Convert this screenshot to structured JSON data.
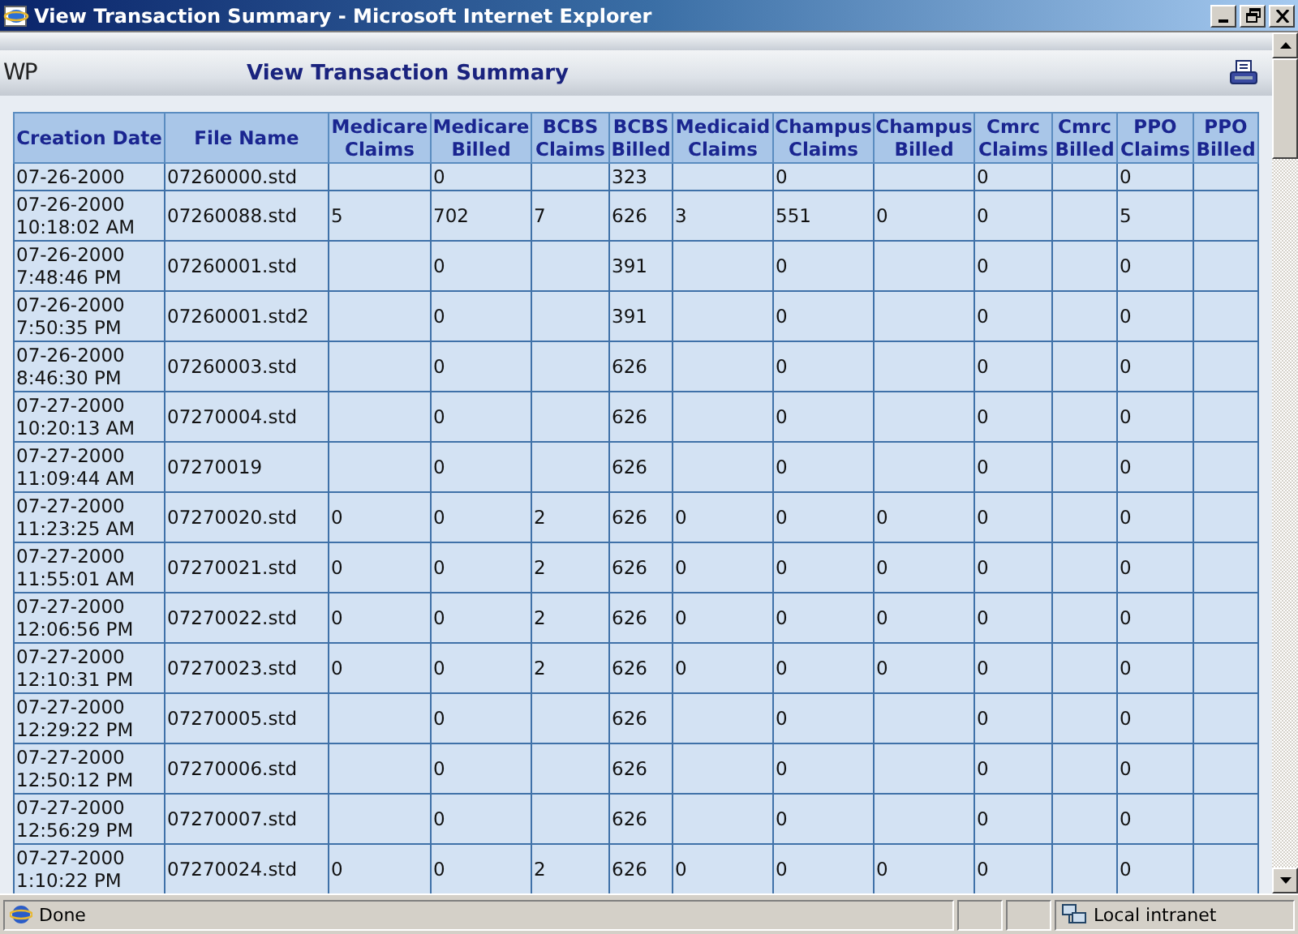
{
  "window": {
    "title": "View Transaction Summary - Microsoft Internet Explorer"
  },
  "page_header": {
    "logo": "WP",
    "title": "View Transaction Summary"
  },
  "table": {
    "columns": [
      "Creation Date",
      "File Name",
      "Medicare Claims",
      "Medicare Billed",
      "BCBS Claims",
      "BCBS Billed",
      "Medicaid Claims",
      "Champus Claims",
      "Champus Billed",
      "Cmrc Claims",
      "Cmrc Billed",
      "PPO Claims",
      "PPO Billed"
    ],
    "rows": [
      {
        "cells": [
          "07-26-2000",
          "07260000.std",
          "",
          "0",
          "",
          "323",
          "",
          "0",
          "",
          "0",
          "",
          "0",
          ""
        ]
      },
      {
        "cells": [
          "07-26-2000 10:18:02 AM",
          "07260088.std",
          "5",
          "702",
          "7",
          "626",
          "3",
          "551",
          "0",
          "0",
          "",
          "5",
          ""
        ]
      },
      {
        "cells": [
          "07-26-2000 7:48:46 PM",
          "07260001.std",
          "",
          "0",
          "",
          "391",
          "",
          "0",
          "",
          "0",
          "",
          "0",
          ""
        ]
      },
      {
        "cells": [
          "07-26-2000 7:50:35 PM",
          "07260001.std2",
          "",
          "0",
          "",
          "391",
          "",
          "0",
          "",
          "0",
          "",
          "0",
          ""
        ]
      },
      {
        "cells": [
          "07-26-2000 8:46:30 PM",
          "07260003.std",
          "",
          "0",
          "",
          "626",
          "",
          "0",
          "",
          "0",
          "",
          "0",
          ""
        ]
      },
      {
        "cells": [
          "07-27-2000 10:20:13 AM",
          "07270004.std",
          "",
          "0",
          "",
          "626",
          "",
          "0",
          "",
          "0",
          "",
          "0",
          ""
        ]
      },
      {
        "cells": [
          "07-27-2000 11:09:44 AM",
          "07270019",
          "",
          "0",
          "",
          "626",
          "",
          "0",
          "",
          "0",
          "",
          "0",
          ""
        ]
      },
      {
        "cells": [
          "07-27-2000 11:23:25 AM",
          "07270020.std",
          "0",
          "0",
          "2",
          "626",
          "0",
          "0",
          "0",
          "0",
          "",
          "0",
          ""
        ]
      },
      {
        "cells": [
          "07-27-2000 11:55:01 AM",
          "07270021.std",
          "0",
          "0",
          "2",
          "626",
          "0",
          "0",
          "0",
          "0",
          "",
          "0",
          ""
        ]
      },
      {
        "cells": [
          "07-27-2000 12:06:56 PM",
          "07270022.std",
          "0",
          "0",
          "2",
          "626",
          "0",
          "0",
          "0",
          "0",
          "",
          "0",
          ""
        ]
      },
      {
        "cells": [
          "07-27-2000 12:10:31 PM",
          "07270023.std",
          "0",
          "0",
          "2",
          "626",
          "0",
          "0",
          "0",
          "0",
          "",
          "0",
          ""
        ]
      },
      {
        "cells": [
          "07-27-2000 12:29:22 PM",
          "07270005.std",
          "",
          "0",
          "",
          "626",
          "",
          "0",
          "",
          "0",
          "",
          "0",
          ""
        ]
      },
      {
        "cells": [
          "07-27-2000 12:50:12 PM",
          "07270006.std",
          "",
          "0",
          "",
          "626",
          "",
          "0",
          "",
          "0",
          "",
          "0",
          ""
        ]
      },
      {
        "cells": [
          "07-27-2000 12:56:29 PM",
          "07270007.std",
          "",
          "0",
          "",
          "626",
          "",
          "0",
          "",
          "0",
          "",
          "0",
          ""
        ]
      },
      {
        "cells": [
          "07-27-2000 1:10:22 PM",
          "07270024.std",
          "0",
          "0",
          "2",
          "626",
          "0",
          "0",
          "0",
          "0",
          "",
          "0",
          ""
        ]
      }
    ]
  },
  "status_bar": {
    "text": "Done",
    "zone": "Local intranet"
  }
}
